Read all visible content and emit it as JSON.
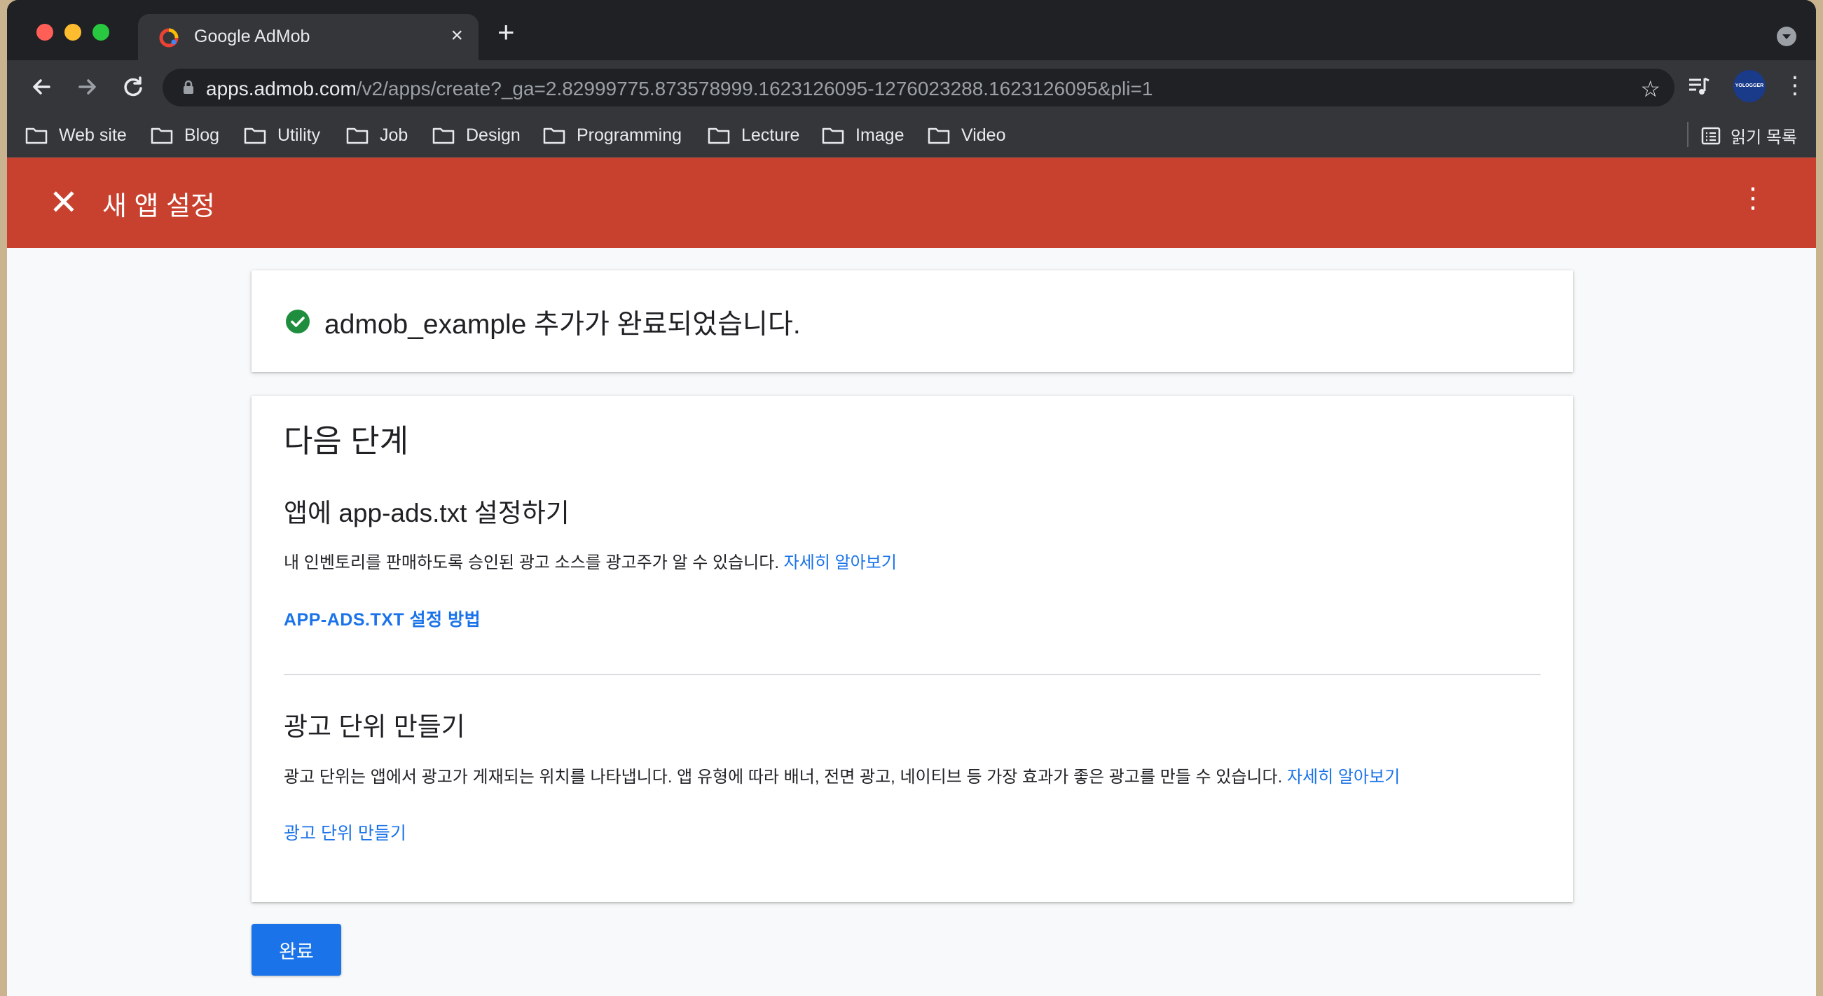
{
  "browser": {
    "tab": {
      "title": "Google AdMob",
      "close_symbol": "×"
    },
    "new_tab_symbol": "+",
    "url_host": "apps.admob.com",
    "url_path": "/v2/apps/create?_ga=2.82999775.873578999.1623126095-1276023288.1623126095&pli=1",
    "profile_text": "YOLOGGER",
    "bookmarks": [
      "Web site",
      "Blog",
      "Utility",
      "Job",
      "Design",
      "Programming",
      "Lecture",
      "Image",
      "Video"
    ],
    "reading_list": "읽기 목록"
  },
  "appbar": {
    "title": "새 앱 설정"
  },
  "success": {
    "message": "admob_example 추가가 완료되었습니다."
  },
  "next_steps": {
    "title": "다음 단계",
    "app_ads": {
      "title": "앱에 app-ads.txt 설정하기",
      "description": "내 인벤토리를 판매하도록 승인된 광고 소스를 광고주가 알 수 있습니다. ",
      "learn_more": "자세히 알아보기",
      "action": "APP-ADS.TXT 설정 방법"
    },
    "ad_units": {
      "title": "광고 단위 만들기",
      "description": "광고 단위는 앱에서 광고가 게재되는 위치를 나타냅니다. 앱 유형에 따라 배너, 전면 광고, 네이티브 등 가장 효과가 좋은 광고를 만들 수 있습니다. ",
      "learn_more": "자세히 알아보기",
      "action": "광고 단위 만들기"
    }
  },
  "done_button": "완료",
  "colors": {
    "appbar": "#c8412f",
    "primary": "#1a73e8",
    "success": "#1e8e3e"
  }
}
